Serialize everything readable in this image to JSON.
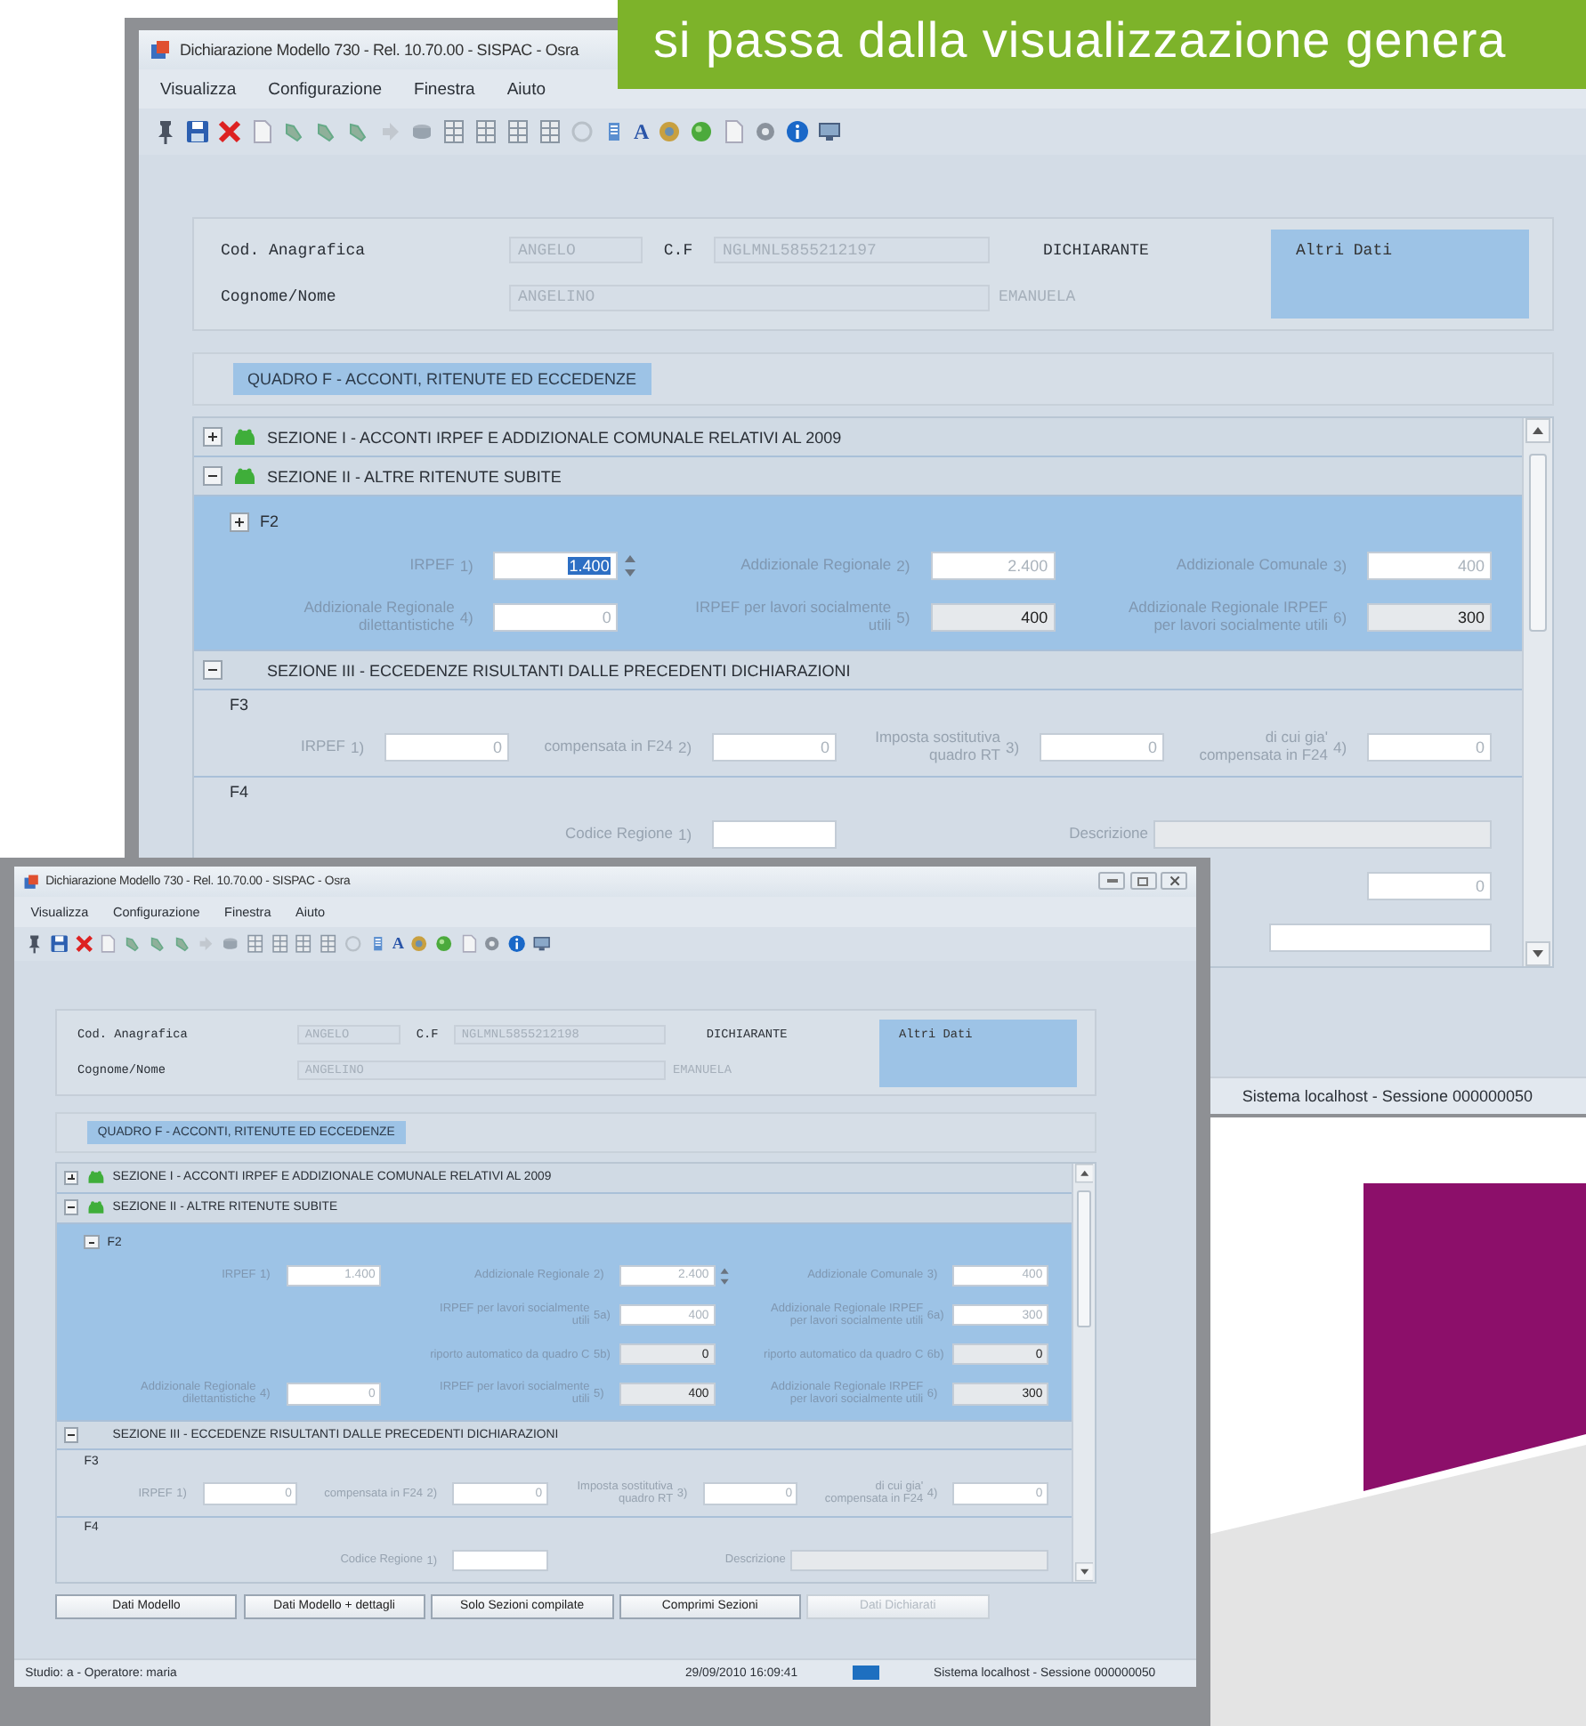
{
  "banner": {
    "text": "si passa dalla visualizzazione genera"
  },
  "back_window": {
    "title": "Dichiarazione Modello 730 - Rel. 10.70.00 - SISPAC - Osra",
    "menu": [
      "Visualizza",
      "Configurazione",
      "Finestra",
      "Aiuto"
    ],
    "toolbar_text": "A",
    "header": {
      "cod_label": "Cod. Anagrafica",
      "cod_value": "ANGELO",
      "cf_label": "C.F",
      "cf_value": "NGLMNL5855212197",
      "role": "DICHIARANTE",
      "name_label": "Cognome/Nome",
      "surname": "ANGELINO",
      "first_name": "EMANUELA",
      "side_panel": "Altri Dati"
    },
    "quadro": "QUADRO F - ACCONTI, RITENUTE ED ECCEDENZE",
    "sections": [
      {
        "kind": "section",
        "title": "SEZIONE I - ACCONTI IRPEF E ADDIZIONALE COMUNALE RELATIVI AL 2009",
        "expanded": false,
        "compiled": true
      },
      {
        "kind": "section",
        "title": "SEZIONE II - ALTRE RITENUTE SUBITE",
        "expanded": true,
        "compiled": true
      },
      {
        "kind": "panel",
        "label": "F2",
        "expanded": false,
        "rows": [
          [
            {
              "label": "IRPEF",
              "number": "1)",
              "value": "1.400",
              "kind": "active"
            },
            {
              "label": "Addizionale Regionale",
              "number": "2)",
              "value": "2.400",
              "kind": "input"
            },
            {
              "label": "Addizionale Comunale",
              "number": "3)",
              "value": "400",
              "kind": "input"
            }
          ],
          [
            {
              "label": "Addizionale Regionale dilettantistiche",
              "number": "4)",
              "value": "0",
              "kind": "input"
            },
            {
              "label": "IRPEF per lavori socialmente utili",
              "number": "5)",
              "value": "400",
              "kind": "readonly"
            },
            {
              "label": "Addizionale Regionale IRPEF per lavori socialmente utili",
              "number": "6)",
              "value": "300",
              "kind": "readonly"
            }
          ]
        ]
      },
      {
        "kind": "section",
        "title": "SEZIONE III - ECCEDENZE RISULTANTI DALLE PRECEDENTI DICHIARAZIONI",
        "expanded": true,
        "compiled": false
      },
      {
        "kind": "group",
        "label": "F3",
        "rows": [
          [
            {
              "label": "IRPEF",
              "number": "1)",
              "value": "0",
              "kind": "input"
            },
            {
              "label": "compensata in F24",
              "number": "2)",
              "value": "0",
              "kind": "input"
            },
            {
              "label": "Imposta sostitutiva quadro RT",
              "number": "3)",
              "value": "0",
              "kind": "input"
            },
            {
              "label": "di cui gia' compensata in F24",
              "number": "4)",
              "value": "0",
              "kind": "input"
            }
          ]
        ]
      },
      {
        "kind": "group",
        "label": "F4",
        "rows": [
          [
            {
              "label": "Codice Regione",
              "number": "1)",
              "kind": "input"
            },
            {
              "label": "Descrizione",
              "kind": "text"
            }
          ],
          [
            {
              "value": "0",
              "kind": "input"
            }
          ],
          [
            {
              "kind": "entry"
            }
          ]
        ]
      }
    ],
    "status": [
      {
        "kind": "text",
        "text": "Sistema localhost - Sessione 000000050"
      }
    ]
  },
  "front_window": {
    "title": "Dichiarazione Modello 730 - Rel. 10.70.00 - SISPAC - Osra",
    "window_controls": true,
    "menu": [
      "Visualizza",
      "Configurazione",
      "Finestra",
      "Aiuto"
    ],
    "toolbar_text": "A",
    "header": {
      "cod_label": "Cod. Anagrafica",
      "cod_value": "ANGELO",
      "cf_label": "C.F",
      "cf_value": "NGLMNL5855212198",
      "role": "DICHIARANTE",
      "name_label": "Cognome/Nome",
      "surname": "ANGELINO",
      "first_name": "EMANUELA",
      "side_panel": "Altri Dati"
    },
    "quadro": "QUADRO F - ACCONTI, RITENUTE ED ECCEDENZE",
    "sections": [
      {
        "kind": "section",
        "title": "SEZIONE I - ACCONTI IRPEF E ADDIZIONALE COMUNALE RELATIVI AL 2009",
        "expanded": false,
        "compiled": true
      },
      {
        "kind": "section",
        "title": "SEZIONE II - ALTRE RITENUTE SUBITE",
        "expanded": true,
        "compiled": true
      },
      {
        "kind": "panel",
        "label": "F2",
        "expanded": true,
        "rows": [
          [
            {
              "label": "IRPEF",
              "number": "1)",
              "value": "1.400",
              "kind": "input"
            },
            {
              "label": "Addizionale Regionale",
              "number": "2)",
              "value": "2.400",
              "kind": "spin"
            },
            {
              "label": "Addizionale Comunale",
              "number": "3)",
              "value": "400",
              "kind": "input"
            }
          ],
          [
            {
              "label": "IRPEF per lavori socialmente utili",
              "number": "5a)",
              "value": "400",
              "kind": "input"
            },
            {
              "label": "Addizionale Regionale IRPEF per lavori socialmente utili",
              "number": "6a)",
              "value": "300",
              "kind": "input"
            }
          ],
          [
            {
              "label": "riporto automatico da quadro C",
              "number": "5b)",
              "value": "0",
              "kind": "readonly"
            },
            {
              "label": "riporto automatico da quadro C",
              "number": "6b)",
              "value": "0",
              "kind": "readonly"
            }
          ],
          [
            {
              "label": "Addizionale Regionale dilettantistiche",
              "number": "4)",
              "value": "0",
              "kind": "input"
            },
            {
              "label": "IRPEF per lavori socialmente utili",
              "number": "5)",
              "value": "400",
              "kind": "readonly"
            },
            {
              "label": "Addizionale Regionale IRPEF per lavori socialmente utili",
              "number": "6)",
              "value": "300",
              "kind": "readonly"
            }
          ]
        ]
      },
      {
        "kind": "section",
        "title": "SEZIONE III - ECCEDENZE RISULTANTI DALLE PRECEDENTI DICHIARAZIONI",
        "expanded": true,
        "compiled": false
      },
      {
        "kind": "group",
        "label": "F3",
        "rows": [
          [
            {
              "label": "IRPEF",
              "number": "1)",
              "value": "0",
              "kind": "input"
            },
            {
              "label": "compensata in F24",
              "number": "2)",
              "value": "0",
              "kind": "input"
            },
            {
              "label": "Imposta sostitutiva quadro RT",
              "number": "3)",
              "value": "0",
              "kind": "input"
            },
            {
              "label": "di cui gia' compensata in F24",
              "number": "4)",
              "value": "0",
              "kind": "input"
            }
          ]
        ]
      },
      {
        "kind": "group",
        "label": "F4",
        "rows": [
          [
            {
              "label": "Codice Regione",
              "number": "1)",
              "kind": "input"
            },
            {
              "label": "Descrizione",
              "kind": "text"
            }
          ]
        ]
      }
    ],
    "buttons": [
      {
        "label": "Dati Modello",
        "disabled": false
      },
      {
        "label": "Dati Modello + dettagli",
        "disabled": false
      },
      {
        "label": "Solo Sezioni compilate",
        "disabled": false
      },
      {
        "label": "Comprimi Sezioni",
        "disabled": false
      },
      {
        "label": "Dati Dichiarati",
        "disabled": true
      }
    ],
    "status": [
      {
        "kind": "text",
        "text": "Studio: a - Operatore: maria"
      },
      {
        "kind": "text",
        "text": "29/09/2010  16:09:41"
      },
      {
        "kind": "indicator"
      },
      {
        "kind": "text",
        "text": "Sistema localhost - Sessione 000000050"
      }
    ]
  }
}
